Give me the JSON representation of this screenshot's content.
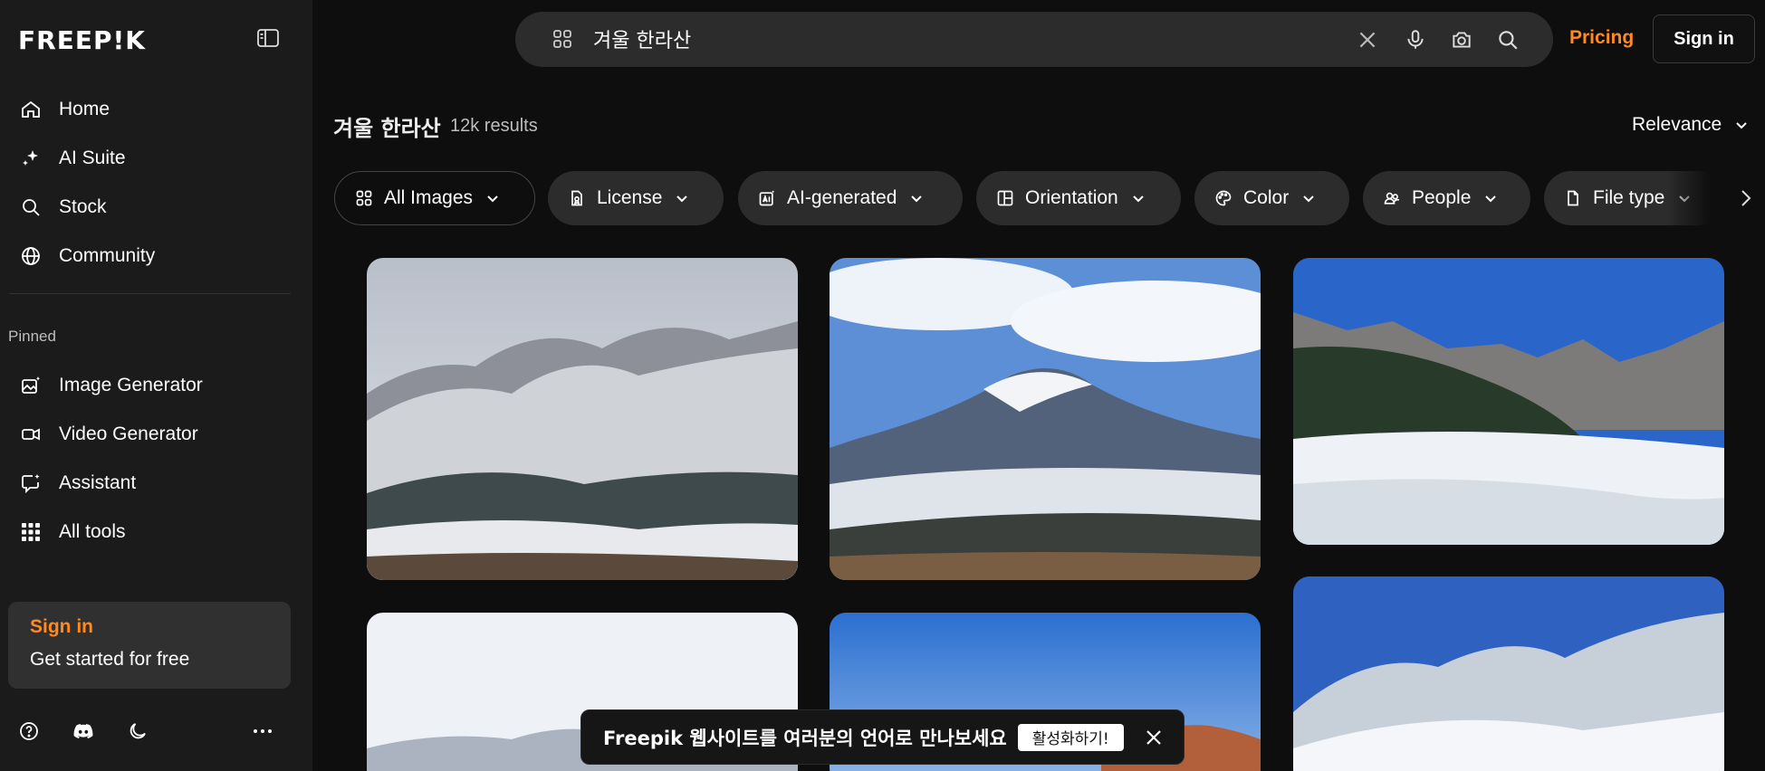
{
  "brand": {
    "logo_text": "FREEP!K",
    "accent": "#ff8a1f"
  },
  "sidebar": {
    "nav": [
      {
        "label": "Home",
        "icon": "home-icon"
      },
      {
        "label": "AI Suite",
        "icon": "sparkle-icon"
      },
      {
        "label": "Stock",
        "icon": "search-icon"
      },
      {
        "label": "Community",
        "icon": "globe-icon"
      }
    ],
    "pinned_label": "Pinned",
    "pinned": [
      {
        "label": "Image Generator",
        "icon": "image-sparkle-icon"
      },
      {
        "label": "Video Generator",
        "icon": "video-icon"
      },
      {
        "label": "Assistant",
        "icon": "chat-sparkle-icon"
      },
      {
        "label": "All tools",
        "icon": "grid-dots-icon"
      }
    ],
    "signin_card": {
      "title": "Sign in",
      "subtitle": "Get started for free"
    }
  },
  "search": {
    "value": "겨울 한라산",
    "placeholder": ""
  },
  "header": {
    "pricing": "Pricing",
    "signin": "Sign in"
  },
  "results": {
    "query": "겨울 한라산",
    "count": "12k results",
    "sort": "Relevance"
  },
  "filters": [
    {
      "label": "All Images",
      "icon": "grid-icon"
    },
    {
      "label": "License",
      "icon": "license-icon"
    },
    {
      "label": "AI-generated",
      "icon": "ai-icon"
    },
    {
      "label": "Orientation",
      "icon": "layout-icon"
    },
    {
      "label": "Color",
      "icon": "palette-icon"
    },
    {
      "label": "People",
      "icon": "people-icon"
    },
    {
      "label": "File type",
      "icon": "file-icon"
    }
  ],
  "banner": {
    "text": "Freepik 웹사이트를 여러분의 언어로 만나보세요",
    "button": "활성화하기!"
  }
}
